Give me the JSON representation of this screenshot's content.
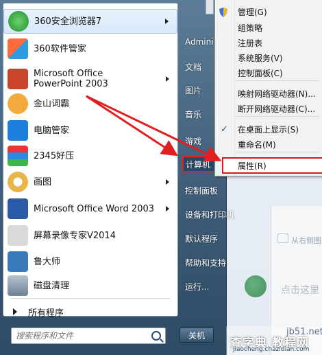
{
  "left_items": [
    {
      "label": "360安全浏览器7",
      "icon": "browser-360-icon",
      "arrow": true,
      "highlight": true
    },
    {
      "label": "360软件管家",
      "icon": "software-manager-icon",
      "arrow": false
    },
    {
      "label": "Microsoft Office PowerPoint 2003",
      "icon": "powerpoint-icon",
      "arrow": true
    },
    {
      "label": "金山词霸",
      "icon": "dictionary-icon",
      "arrow": false
    },
    {
      "label": "电脑管家",
      "icon": "pc-manager-icon",
      "arrow": false
    },
    {
      "label": "2345好压",
      "icon": "archive-icon",
      "arrow": false
    },
    {
      "label": "画图",
      "icon": "paint-icon",
      "arrow": true
    },
    {
      "label": "Microsoft Office Word 2003",
      "icon": "word-icon",
      "arrow": true
    },
    {
      "label": "屏幕录像专家V2014",
      "icon": "screen-recorder-icon",
      "arrow": false
    },
    {
      "label": "鲁大师",
      "icon": "ludashi-icon",
      "arrow": false
    },
    {
      "label": "磁盘清理",
      "icon": "disk-cleanup-icon",
      "arrow": false
    }
  ],
  "all_programs": "所有程序",
  "search": {
    "placeholder": "搜索程序和文件"
  },
  "right_items": [
    {
      "label": "Admini",
      "selected": false
    },
    {
      "label": "文档",
      "selected": false
    },
    {
      "label": "图片",
      "selected": false
    },
    {
      "label": "音乐",
      "selected": false
    },
    {
      "label": "游戏",
      "selected": false
    },
    {
      "label": "计算机",
      "selected": true
    },
    {
      "label": "控制面板",
      "selected": false
    },
    {
      "label": "设备和打印机",
      "selected": false
    },
    {
      "label": "默认程序",
      "selected": false
    },
    {
      "label": "帮助和支持",
      "selected": false
    },
    {
      "label": "运行...",
      "selected": false
    }
  ],
  "shutdown_label": "关机",
  "context_menu": [
    {
      "label": "管理(G)",
      "icon": "shield"
    },
    {
      "label": "组策略"
    },
    {
      "label": "注册表"
    },
    {
      "label": "系统服务(V)"
    },
    {
      "label": "控制面板(C)"
    },
    {
      "label": "映射网络驱动器(N)..."
    },
    {
      "label": "断开网络驱动器(C)..."
    },
    {
      "label": "在桌面上显示(S)",
      "checked": true
    },
    {
      "label": "重命名(M)"
    },
    {
      "label": "属性(R)",
      "boxed": true
    }
  ],
  "desktop": {
    "text_small": "从右侧图",
    "text_large": "点击这里"
  },
  "watermark": {
    "line1": "jb51.net",
    "line2": "查字典 教程网",
    "line3": "jiaocheng.chazidian.com"
  },
  "colors": {
    "accent_red": "#cc1d1d",
    "menu_blue": "#3f5d78"
  }
}
